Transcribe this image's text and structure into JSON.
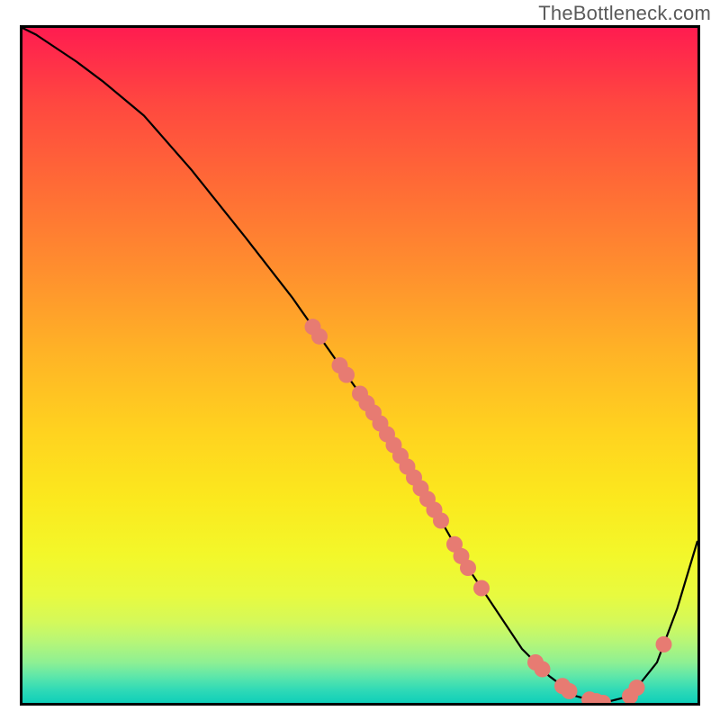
{
  "watermark": "TheBottleneck.com",
  "chart_data": {
    "type": "line",
    "title": "",
    "xlabel": "",
    "ylabel": "",
    "xlim": [
      0,
      100
    ],
    "ylim": [
      0,
      100
    ],
    "grid": false,
    "series": [
      {
        "name": "curve",
        "color": "#000000",
        "x": [
          0,
          2,
          5,
          8,
          12,
          18,
          25,
          33,
          40,
          47,
          52,
          57,
          62,
          66,
          70,
          74,
          78,
          82,
          86,
          90,
          94,
          97,
          100
        ],
        "y": [
          100,
          99,
          97,
          95,
          92,
          87,
          79,
          69,
          60,
          50,
          43,
          35,
          27,
          20,
          14,
          8,
          4,
          1,
          0,
          1,
          6,
          14,
          24
        ]
      }
    ],
    "dot_color": "#e77b72",
    "dot_radius": 9,
    "dots_on_curve_x": [
      43,
      44,
      47,
      48,
      50,
      51,
      52,
      53,
      54,
      55,
      56,
      57,
      58,
      59,
      60,
      61,
      62,
      64,
      65,
      66,
      68,
      76,
      77,
      80,
      81,
      84,
      85,
      86,
      90,
      91,
      95
    ]
  },
  "gradient_stops": [
    {
      "pct": 0,
      "color": "#ff1c50"
    },
    {
      "pct": 11,
      "color": "#ff4740"
    },
    {
      "pct": 23,
      "color": "#ff6a36"
    },
    {
      "pct": 36,
      "color": "#ff8f2e"
    },
    {
      "pct": 48,
      "color": "#ffb326"
    },
    {
      "pct": 60,
      "color": "#ffd31f"
    },
    {
      "pct": 70,
      "color": "#fbe91e"
    },
    {
      "pct": 78,
      "color": "#f3f72a"
    },
    {
      "pct": 84,
      "color": "#e8fa3f"
    },
    {
      "pct": 88,
      "color": "#d4f95a"
    },
    {
      "pct": 91,
      "color": "#b6f678"
    },
    {
      "pct": 94,
      "color": "#8ef093"
    },
    {
      "pct": 96,
      "color": "#5fe7a9"
    },
    {
      "pct": 98,
      "color": "#31dab6"
    },
    {
      "pct": 100,
      "color": "#0fcfb9"
    }
  ]
}
